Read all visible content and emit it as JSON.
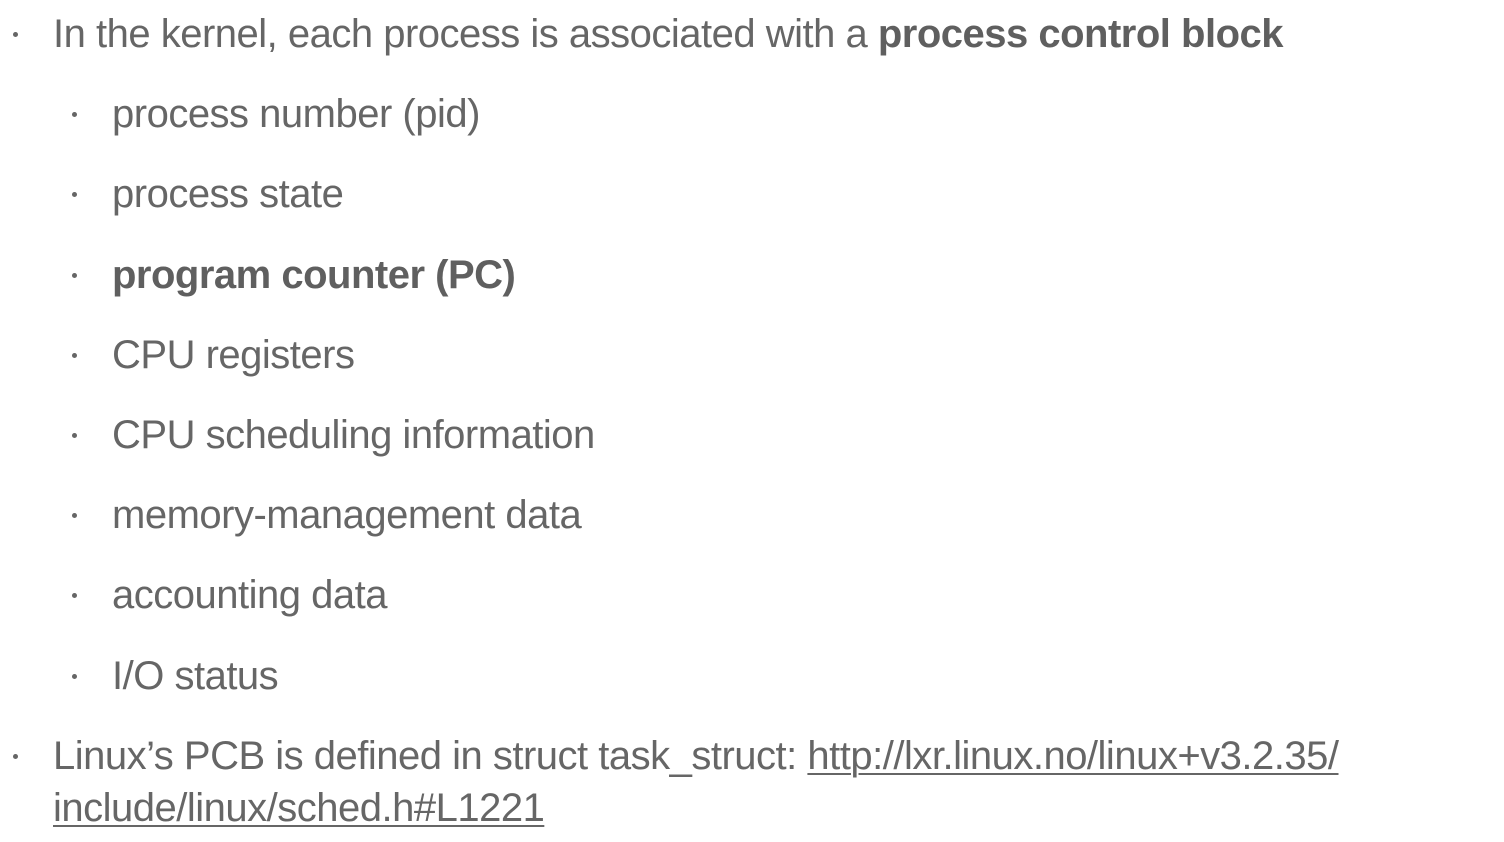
{
  "bullets": {
    "intro": {
      "text": "In the kernel, each process is associated with a ",
      "bold": "process control block"
    },
    "sub_items": [
      {
        "label": "process number (pid)",
        "bold": false
      },
      {
        "label": "process state",
        "bold": false
      },
      {
        "label": "program counter (PC)",
        "bold": true
      },
      {
        "label": "CPU registers",
        "bold": false
      },
      {
        "label": "CPU scheduling information",
        "bold": false
      },
      {
        "label": "memory-management data",
        "bold": false
      },
      {
        "label": "accounting data",
        "bold": false
      },
      {
        "label": "I/O status",
        "bold": false
      }
    ],
    "linux": {
      "text": "Linux’s PCB is defined in struct task_struct: ",
      "link_line1": "http://lxr.linux.no/linux+v3.2.35/",
      "link_line2": "include/linux/sched.h#L1221"
    }
  }
}
